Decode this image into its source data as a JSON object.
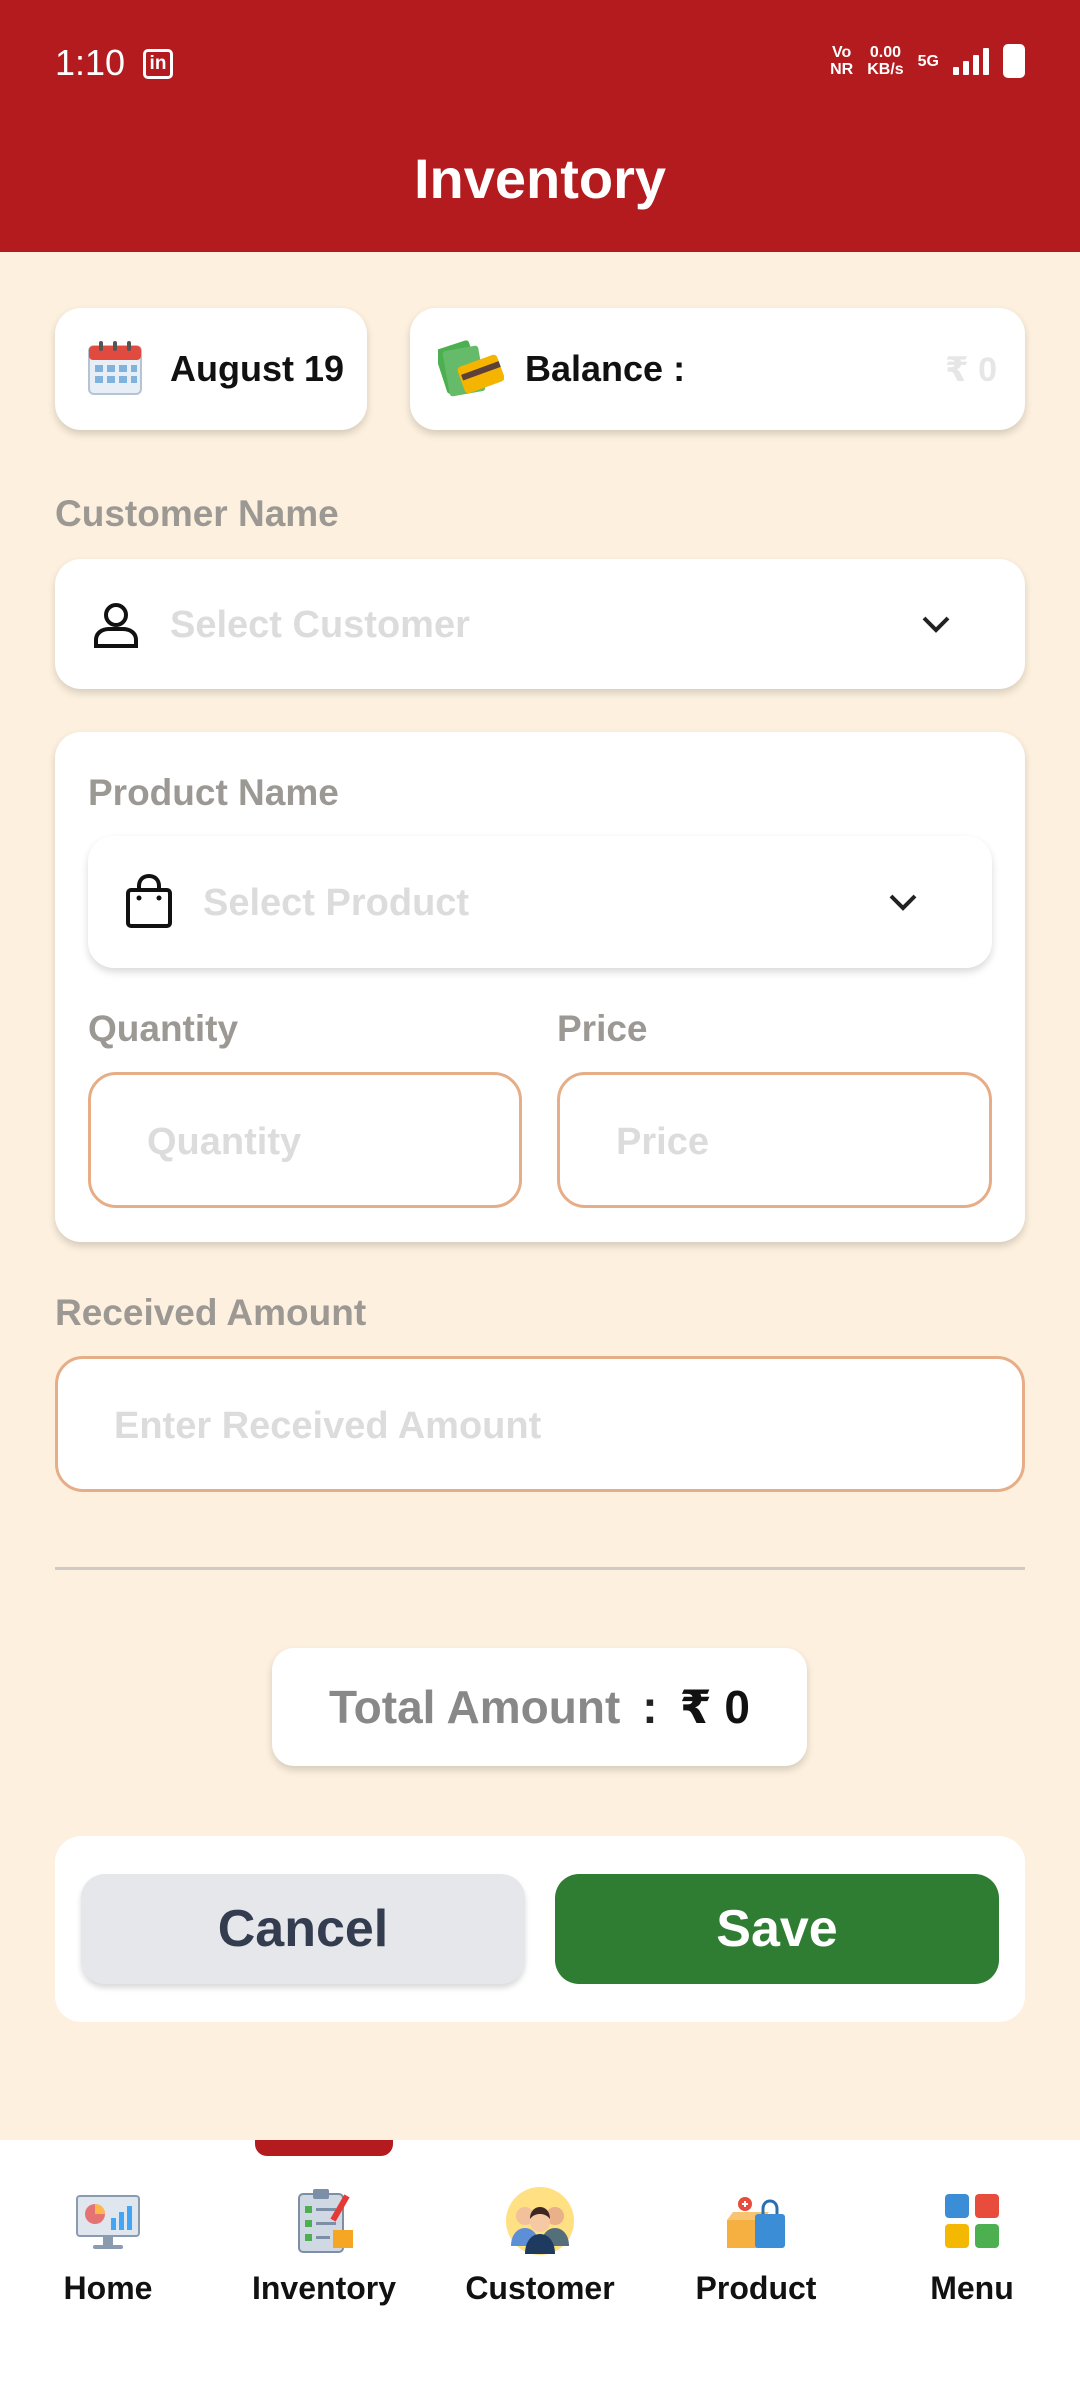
{
  "status_bar": {
    "time": "1:10",
    "app_icon": "linkedin-icon",
    "network_top": "Vo",
    "network_bottom": "NR",
    "speed_top": "0.00",
    "speed_bottom": "KB/s",
    "signal_type": "5G"
  },
  "header": {
    "title": "Inventory",
    "color": "#b31b1e"
  },
  "date_card": {
    "icon": "calendar-icon",
    "label": "August 19"
  },
  "balance_card": {
    "icon": "money-card-icon",
    "label": "Balance :",
    "value": "₹ 0"
  },
  "customer": {
    "label": "Customer Name",
    "icon": "person-icon",
    "placeholder": "Select Customer"
  },
  "product": {
    "label": "Product Name",
    "icon": "shopping-bag-icon",
    "placeholder": "Select Product",
    "quantity_label": "Quantity",
    "quantity_placeholder": "Quantity",
    "price_label": "Price",
    "price_placeholder": "Price"
  },
  "received": {
    "label": "Received Amount",
    "placeholder": "Enter Received Amount"
  },
  "total": {
    "label": "Total Amount",
    "colon": ":",
    "value": "₹ 0"
  },
  "buttons": {
    "cancel": "Cancel",
    "save": "Save",
    "save_color": "#2e7d32"
  },
  "nav": {
    "active": "Inventory",
    "items": [
      {
        "label": "Home",
        "icon": "dashboard-chart-icon"
      },
      {
        "label": "Inventory",
        "icon": "clipboard-checklist-icon"
      },
      {
        "label": "Customer",
        "icon": "people-group-icon"
      },
      {
        "label": "Product",
        "icon": "box-bag-icon"
      },
      {
        "label": "Menu",
        "icon": "grid-menu-icon"
      }
    ]
  }
}
